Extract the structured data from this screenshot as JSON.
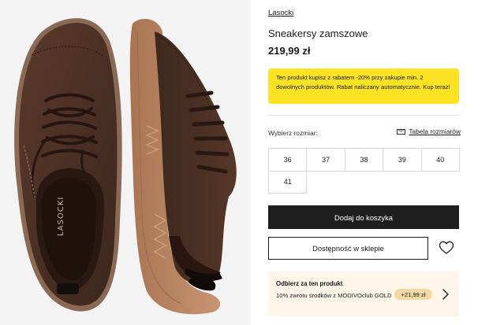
{
  "product": {
    "brand": "Lasocki",
    "name": "Sneakersy zamszowe",
    "price": "219,99 zł",
    "promo_text": "Ten produkt kupisz z rabatem -20% przy zakupie min. 2 dowolnych produktów. Rabat naliczany automatycznie. Kup teraz!",
    "insole_logo": "LASOCKI"
  },
  "sizes": {
    "label": "Wybierz rozmiar:",
    "table_link": "Tabela rozmiarów",
    "options": [
      "36",
      "37",
      "38",
      "39",
      "40",
      "41"
    ]
  },
  "actions": {
    "add_to_cart": "Dodaj do koszyka",
    "store_availability": "Dostępność w sklepie"
  },
  "reward": {
    "title": "Odbierz za ten produkt",
    "description": "10% zwrotu środków z MODIVOclub GOLD",
    "amount": "+21,99 zł"
  },
  "colors": {
    "promo_bg": "#fbe324",
    "cart_button": "#1f1f1f",
    "reward_bg": "#fdf6e9",
    "reward_badge": "#f1d9a4",
    "suede": "#4a3024",
    "sole": "#b98561"
  },
  "icons": {
    "size_table": "ruler-icon",
    "wishlist": "heart-icon",
    "reward_next": "chevron-right-icon"
  }
}
